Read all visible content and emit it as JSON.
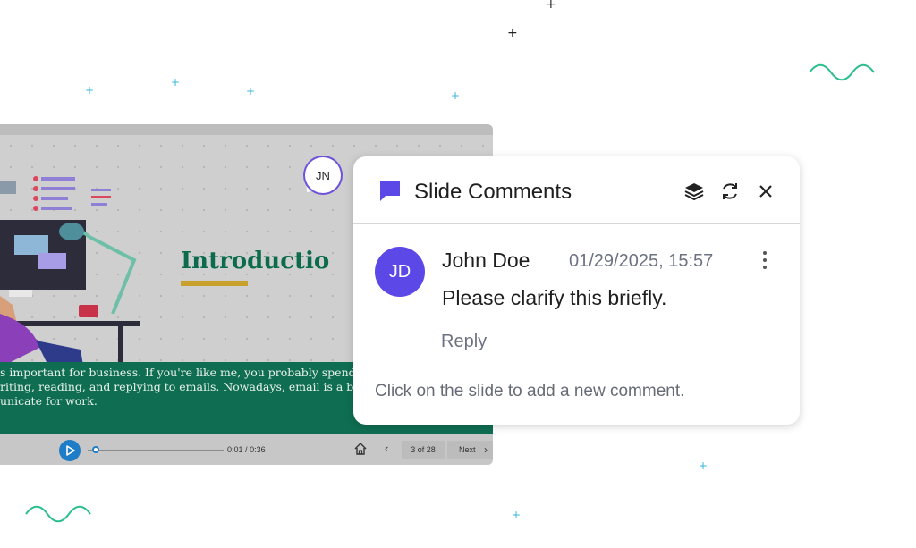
{
  "colors": {
    "accent": "#5b48e6",
    "slide_green": "#0f6e52",
    "title_green": "#0d6b4d",
    "decor_blue": "#39b5e0",
    "squiggle_green": "#2bbf8c"
  },
  "slide": {
    "title": "Introductio",
    "caption_lines": [
      "s important for business. If you're like me, you probably spend",
      "riting, reading, and replying to emails. Nowadays, email is a big",
      "unicate for work."
    ]
  },
  "player": {
    "current_time": "0:01",
    "time_separator": "/",
    "duration": "0:36",
    "page_indicator": "3 of 28",
    "next_label": "Next",
    "progress": 0.03
  },
  "marker": {
    "initials": "JN"
  },
  "comments_panel": {
    "title": "Slide Comments",
    "icons": [
      "comment-icon",
      "layers-icon",
      "refresh-icon",
      "close-icon"
    ],
    "comment": {
      "avatar_initials": "JD",
      "author": "John Doe",
      "timestamp": "01/29/2025, 15:57",
      "text": "Please clarify this briefly.",
      "reply_label": "Reply"
    },
    "hint": "Click on the slide to add a new comment."
  }
}
